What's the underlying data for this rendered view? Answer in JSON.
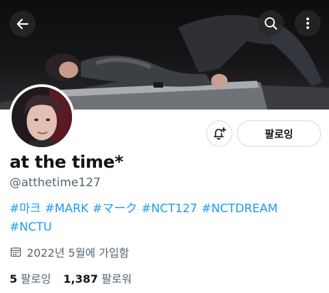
{
  "profile": {
    "display_name": "at the time*",
    "handle": "@atthetime127",
    "bio_tags": [
      "#마크",
      "#MARK",
      "#マーク",
      "#NCT127",
      "#NCTDREAM",
      "#NCTU"
    ],
    "joined": "2022년 5월에 가입함"
  },
  "stats": {
    "following_count": "5",
    "following_label": "팔로잉",
    "followers_count": "1,387",
    "followers_label": "팔로워"
  },
  "actions": {
    "follow_label": "팔로잉"
  },
  "icons": {
    "back": "back-arrow-icon",
    "search": "search-icon",
    "more": "more-vertical-icon",
    "notify": "bell-plus-icon",
    "calendar": "calendar-icon"
  },
  "colors": {
    "link": "#1d9bf0",
    "secondary_text": "#536471",
    "primary_text": "#0f1419"
  }
}
